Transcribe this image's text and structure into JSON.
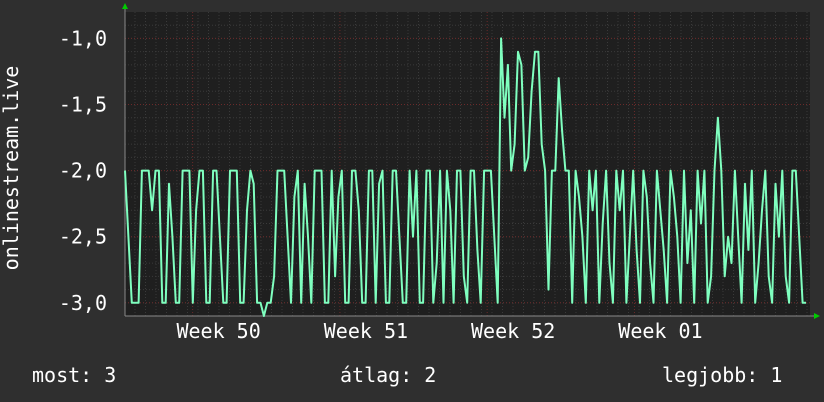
{
  "chart_data": {
    "type": "line",
    "ylabel": "onlinestream.live",
    "ylim": [
      -3.1,
      -0.8
    ],
    "yticks": [
      -1.0,
      -1.5,
      -2.0,
      -2.5,
      -3.0
    ],
    "ytick_labels": [
      "-1,0",
      "-1,5",
      "-2,0",
      "-2,5",
      "-3,0"
    ],
    "xlim": [
      0,
      1
    ],
    "xticks": [
      {
        "label": "Week 50",
        "x": 0.125
      },
      {
        "label": "Week 51",
        "x": 0.34
      },
      {
        "label": "Week 52",
        "x": 0.555
      },
      {
        "label": "Week 01",
        "x": 0.77
      }
    ],
    "grid": true,
    "colors": {
      "line": "#7fffbf",
      "plot_bg": "#1f1f1f",
      "grid_minor": "#3a3a3a",
      "grid_major": "#6b2a2a",
      "axis": "#888888",
      "arrow": "#00cc00"
    },
    "series": [
      {
        "values": [
          -2.0,
          -2.5,
          -3.0,
          -3.0,
          -3.0,
          -2.0,
          -2.0,
          -2.0,
          -2.3,
          -2.0,
          -2.0,
          -3.0,
          -3.0,
          -2.1,
          -2.5,
          -3.0,
          -3.0,
          -2.0,
          -2.0,
          -2.0,
          -3.0,
          -2.3,
          -2.0,
          -2.0,
          -3.0,
          -3.0,
          -2.0,
          -2.0,
          -2.5,
          -3.0,
          -3.0,
          -2.0,
          -2.0,
          -2.0,
          -3.0,
          -3.0,
          -2.3,
          -2.0,
          -2.1,
          -3.0,
          -3.0,
          -3.1,
          -3.0,
          -3.0,
          -2.8,
          -2.0,
          -2.0,
          -2.0,
          -2.5,
          -3.0,
          -2.2,
          -2.0,
          -3.0,
          -2.1,
          -2.5,
          -3.0,
          -2.0,
          -2.0,
          -2.0,
          -3.0,
          -3.0,
          -2.0,
          -2.8,
          -2.2,
          -2.0,
          -3.0,
          -3.0,
          -2.0,
          -2.0,
          -2.3,
          -3.0,
          -3.0,
          -2.0,
          -2.0,
          -3.0,
          -2.1,
          -2.0,
          -3.0,
          -3.0,
          -2.0,
          -2.0,
          -2.5,
          -3.0,
          -3.0,
          -2.0,
          -2.5,
          -2.0,
          -3.0,
          -3.0,
          -2.0,
          -2.0,
          -3.0,
          -2.7,
          -2.0,
          -3.0,
          -2.0,
          -2.3,
          -3.0,
          -2.0,
          -2.0,
          -2.8,
          -3.0,
          -2.0,
          -2.0,
          -2.6,
          -3.0,
          -2.0,
          -2.0,
          -2.0,
          -2.5,
          -3.0,
          -1.0,
          -1.6,
          -1.2,
          -2.0,
          -1.8,
          -1.1,
          -1.2,
          -2.0,
          -1.9,
          -1.4,
          -1.1,
          -1.1,
          -1.8,
          -2.0,
          -2.9,
          -2.0,
          -2.0,
          -1.3,
          -1.7,
          -2.0,
          -2.0,
          -3.0,
          -2.0,
          -2.2,
          -2.5,
          -3.0,
          -2.0,
          -2.3,
          -2.0,
          -3.0,
          -2.4,
          -2.0,
          -2.7,
          -3.0,
          -2.0,
          -2.3,
          -2.0,
          -3.0,
          -2.5,
          -2.0,
          -2.6,
          -3.0,
          -2.0,
          -2.2,
          -2.7,
          -3.0,
          -2.0,
          -2.3,
          -2.6,
          -3.0,
          -2.0,
          -2.2,
          -2.5,
          -3.0,
          -2.0,
          -2.7,
          -2.3,
          -3.0,
          -2.0,
          -2.4,
          -2.0,
          -3.0,
          -2.8,
          -2.0,
          -1.6,
          -2.0,
          -2.8,
          -2.5,
          -2.7,
          -2.0,
          -2.5,
          -3.0,
          -2.1,
          -2.6,
          -2.0,
          -3.0,
          -2.7,
          -2.3,
          -2.0,
          -2.8,
          -3.0,
          -2.1,
          -2.5,
          -2.0,
          -2.8,
          -3.0,
          -2.0,
          -2.0,
          -2.5,
          -3.0,
          -3.0
        ]
      }
    ],
    "annotations": [
      "most: 3",
      "átlag: 2",
      "legjobb: 1"
    ]
  },
  "footer": {
    "current": "most: 3",
    "average": "átlag: 2",
    "best": "legjobb: 1"
  }
}
